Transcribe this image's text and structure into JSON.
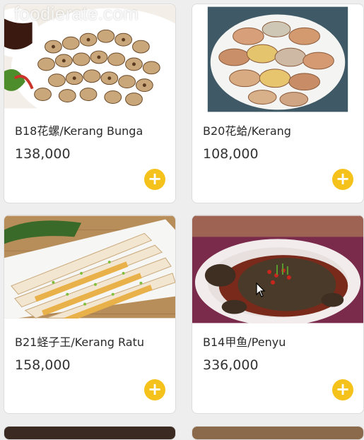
{
  "watermark": "foodierate.com",
  "accent_color": "#f5c21b",
  "items": [
    {
      "name": "B18花螺/Kerang Bunga",
      "price": "138,000",
      "add_icon": "plus-icon",
      "add_glyph": "+"
    },
    {
      "name": "B20花蛤/Kerang",
      "price": "108,000",
      "add_icon": "plus-icon",
      "add_glyph": "+"
    },
    {
      "name": "B21蛏子王/Kerang Ratu",
      "price": "158,000",
      "add_icon": "plus-icon",
      "add_glyph": "+"
    },
    {
      "name": "B14甲鱼/Penyu",
      "price": "336,000",
      "add_icon": "plus-icon",
      "add_glyph": "+"
    }
  ]
}
